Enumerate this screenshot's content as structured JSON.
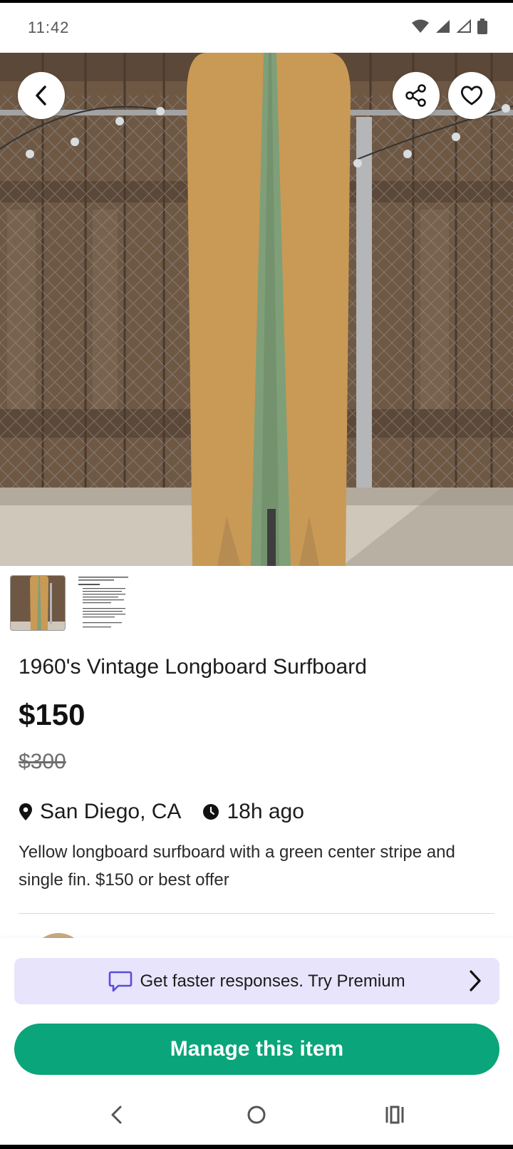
{
  "status_bar": {
    "time": "11:42",
    "icons": [
      "wifi-icon",
      "signal-icon",
      "signal-empty-icon",
      "battery-icon"
    ]
  },
  "hero": {
    "alt": "Yellow longboard surfboard with green center stripe leaning against wooden fence",
    "buttons": [
      "back-icon",
      "share-icon",
      "heart-icon"
    ]
  },
  "thumbnails": [
    "photo-surfboard",
    "photo-document"
  ],
  "listing": {
    "title": "1960's Vintage Longboard Surfboard",
    "price": "$150",
    "original_price": "$300",
    "location": "San Diego, CA",
    "posted": "18h ago",
    "description": "Yellow longboard surfboard with a green center stripe and single fin. $150 or best offer"
  },
  "premium": {
    "label": "Get faster responses.  Try Premium"
  },
  "cta": {
    "manage_label": "Manage this item"
  },
  "colors": {
    "accent_green": "#0aa57a",
    "premium_bg": "#e8e4fb",
    "premium_icon": "#5b4cdb"
  }
}
